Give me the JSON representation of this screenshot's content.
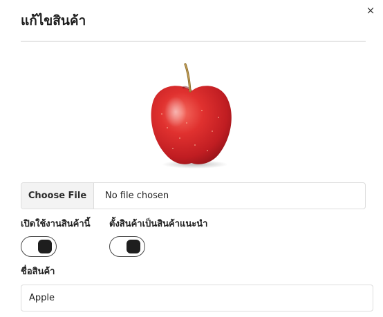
{
  "modal": {
    "title": "แก้ไขสินค้า",
    "close_icon": "×"
  },
  "image": {
    "subject": "apple"
  },
  "file_input": {
    "button_label": "Choose File",
    "status": "No file chosen"
  },
  "toggles": [
    {
      "label": "เปิดใช้งานสินค้านี้",
      "enabled": true
    },
    {
      "label": "ตั้งสินค้าเป็นสินค้าแนะนำ",
      "enabled": true
    }
  ],
  "name_field": {
    "label": "ชื่อสินค้า",
    "value": "Apple"
  },
  "colors": {
    "toggle_knob": "#1e1e1e",
    "apple_red": "#d8262c"
  }
}
